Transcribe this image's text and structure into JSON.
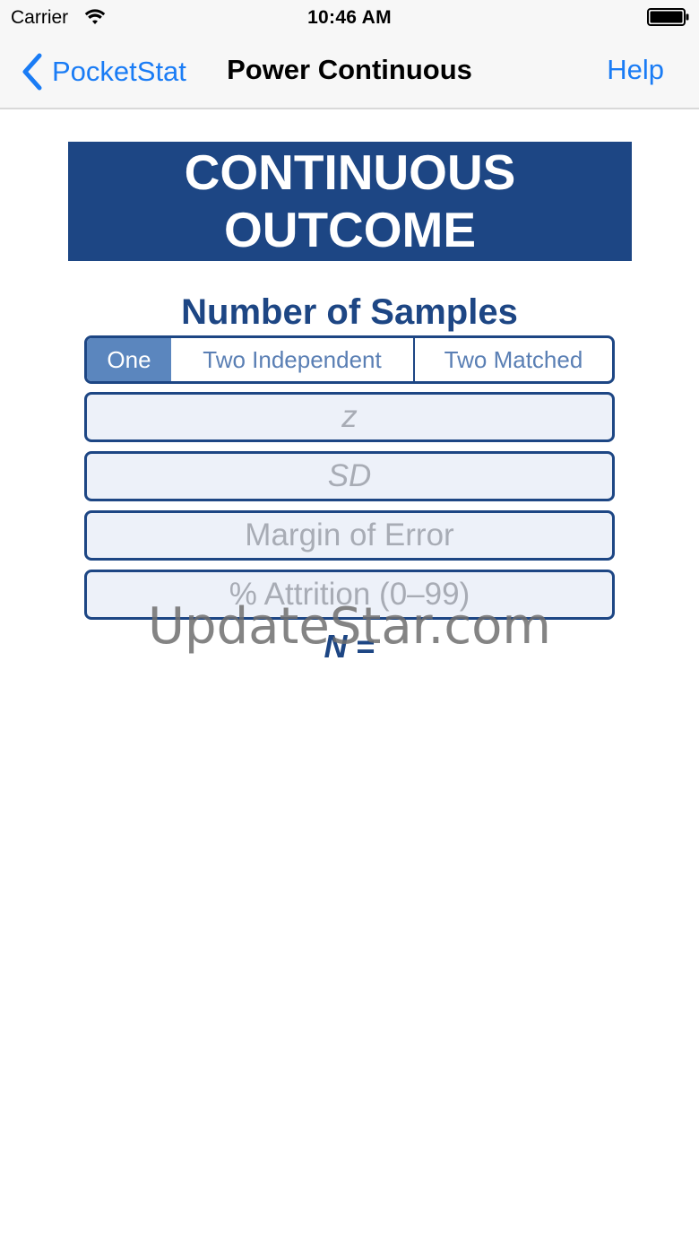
{
  "status_bar": {
    "carrier": "Carrier",
    "time": "10:46 AM",
    "icons": [
      "wifi-icon",
      "battery-icon"
    ]
  },
  "nav": {
    "back_label": "PocketStat",
    "title": "Power Continuous",
    "help_label": "Help",
    "accent_color": "#1a7cf5"
  },
  "banner": {
    "line1": "CONTINUOUS",
    "line2": "OUTCOME",
    "background": "#1d4684"
  },
  "samples": {
    "title": "Number of Samples",
    "options": [
      "One",
      "Two Independent",
      "Two Matched"
    ],
    "selected": "One"
  },
  "fields": {
    "z": {
      "placeholder": "z",
      "value": ""
    },
    "sd": {
      "placeholder": "SD",
      "value": ""
    },
    "margin_of_error": {
      "placeholder": "Margin of Error",
      "value": ""
    },
    "attrition": {
      "placeholder": "% Attrition (0–99)",
      "value": ""
    }
  },
  "result": {
    "symbol": "N",
    "equals": " =",
    "value": ""
  },
  "watermark": "UpdateStar.com"
}
